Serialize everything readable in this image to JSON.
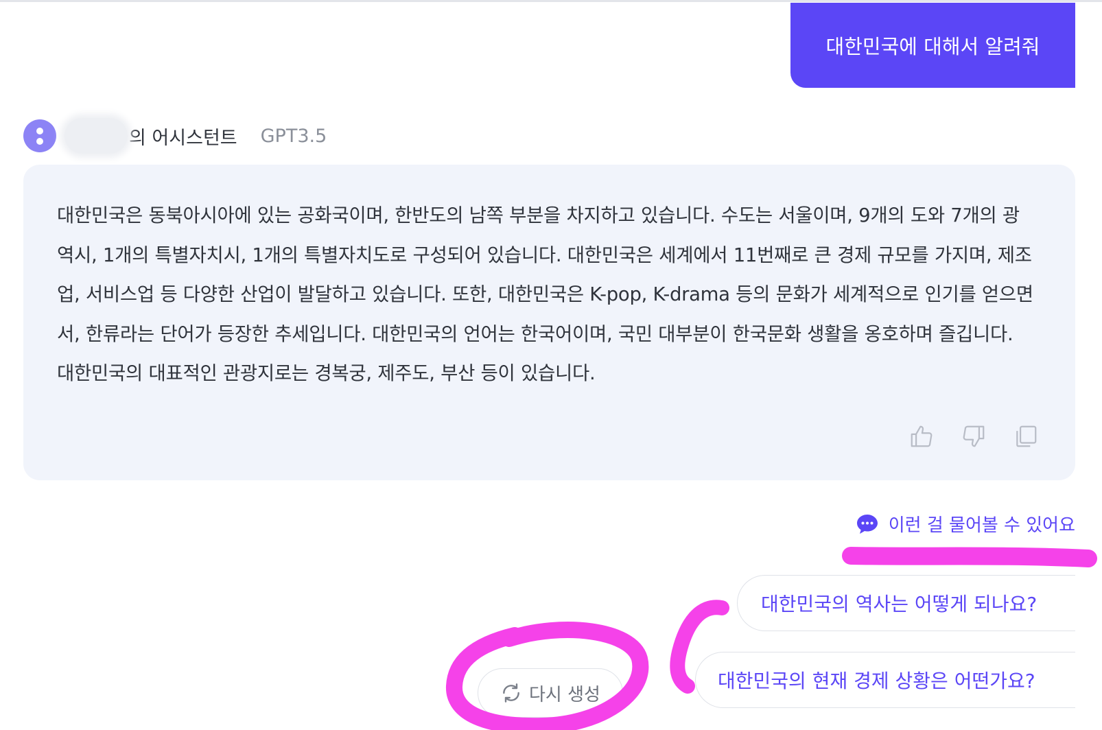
{
  "theme": {
    "accent": "#5b46f6",
    "annotation": "#f542e9"
  },
  "user_message": {
    "text": "대한민국에 대해서 알려줘"
  },
  "assistant": {
    "name_suffix": "의 어시스턴트",
    "model": "GPT3.5",
    "response": "대한민국은 동북아시아에 있는 공화국이며, 한반도의 남쪽 부분을 차지하고 있습니다. 수도는 서울이며, 9개의 도와 7개의 광역시, 1개의 특별자치시, 1개의 특별자치도로 구성되어 있습니다. 대한민국은 세계에서 11번째로 큰 경제 규모를 가지며, 제조업, 서비스업 등 다양한 산업이 발달하고 있습니다. 또한, 대한민국은 K-pop, K-drama 등의 문화가 세계적으로 인기를 얻으면서, 한류라는 단어가 등장한 추세입니다. 대한민국의 언어는 한국어이며, 국민 대부분이 한국문화 생활을 옹호하며 즐깁니다. 대한민국의 대표적인 관광지로는 경복궁, 제주도, 부산 등이 있습니다.",
    "actions": [
      {
        "icon": "thumbs-up-icon"
      },
      {
        "icon": "thumbs-down-icon"
      },
      {
        "icon": "copy-icon"
      }
    ]
  },
  "suggestions": {
    "label": "이런 걸 물어볼 수 있어요",
    "icon": "chat-bubble-icon",
    "items": [
      "대한민국의 역사는 어떻게 되나요?",
      "대한민국의 현재 경제 상황은 어떤가요?"
    ]
  },
  "regenerate": {
    "label": "다시 생성",
    "icon": "refresh-icon"
  }
}
